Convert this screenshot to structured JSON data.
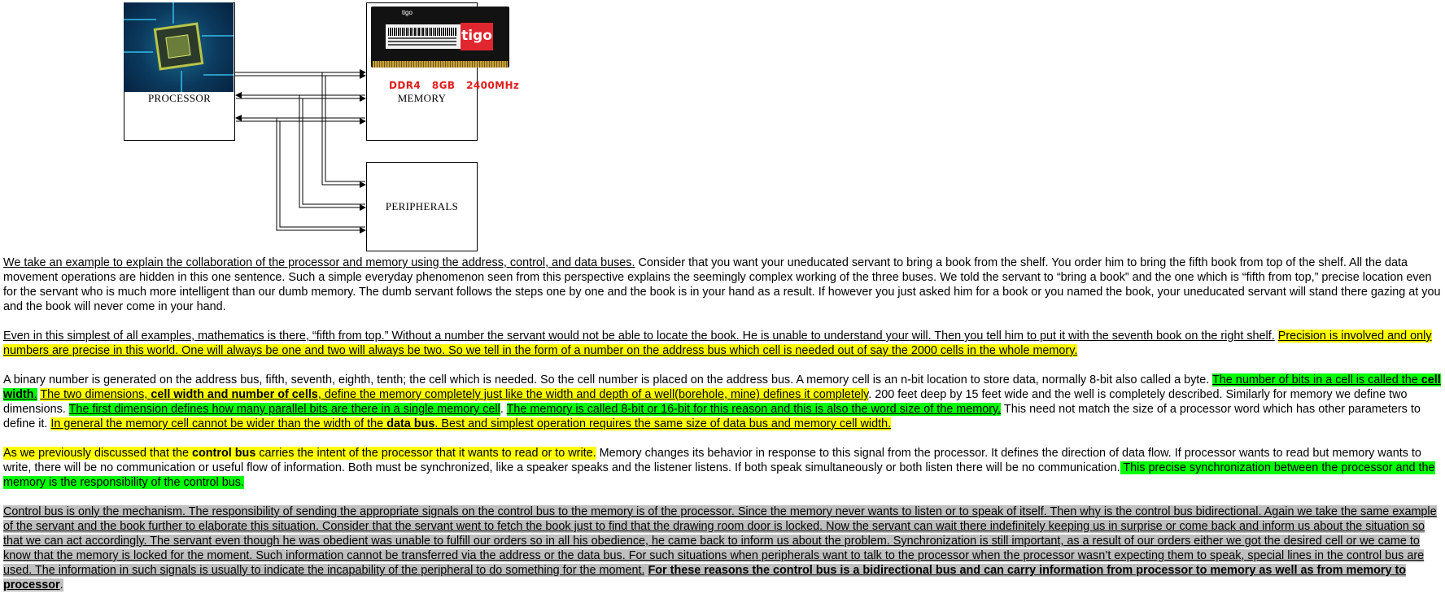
{
  "diagram": {
    "processor_label": "PROCESSOR",
    "memory_label": "MEMORY",
    "peripherals_label": "PERIPHERALS",
    "ram_brand": "tigo",
    "ram_spec": "DDR4   8GB   2400MHz",
    "chip_icon": "cpu-chip-image",
    "ram_icon": "ram-module-image"
  },
  "paragraphs": [
    {
      "runs": [
        {
          "t": "We take an example to explain the collaboration of the processor and memory using the address, control, and data buses.",
          "u": true
        },
        {
          "t": " Consider that you want your uneducated servant to bring a book from the shelf. You order him to bring the fifth book from top of the shelf. All the data movement operations are hidden in this one sentence. Such a simple everyday phenomenon seen from this perspective explains the seemingly complex working of the three buses. We told the servant to “bring a book” and the one which is “fifth from top,” precise location even for the servant who is much more intelligent than our dumb memory. The dumb servant follows the steps one by one and the book is in your hand as a result. If however you just asked him for a book or you named the book, your uneducated servant will stand there gazing at you and the book will never come in your hand."
        }
      ]
    },
    {
      "runs": [
        {
          "t": "Even in this simplest of all examples, mathematics is there, “fifth from top.” Without a number the servant would not be able to locate the book. He is unable to understand your will. Then you tell him to put it with the seventh book on the right shelf.",
          "u": true
        },
        {
          "t": " "
        },
        {
          "t": "Precision is involved and only numbers are precise in this world. One will always be one and two will always be two. So we tell in the form of a number on the address bus which cell is needed out of say the 2000 cells in the whole memory.",
          "u": true,
          "h": "yellow"
        }
      ]
    },
    {
      "runs": [
        {
          "t": "A binary number is generated on the address bus, fifth, seventh, eighth, tenth; the cell which is needed. So the cell number is placed on the address bus. A memory cell is an n-bit location to store data, normally 8-bit also called a byte. "
        },
        {
          "t": "The number of bits in a cell is called the ",
          "u": true,
          "h": "green"
        },
        {
          "t": "cell width",
          "u": true,
          "b": true,
          "h": "green"
        },
        {
          "t": ".",
          "u": true,
          "h": "green"
        },
        {
          "t": " "
        },
        {
          "t": "The two dimensions, ",
          "u": true,
          "h": "yellow"
        },
        {
          "t": "cell width and number of cells",
          "u": true,
          "b": true,
          "h": "yellow"
        },
        {
          "t": ", define the memory completely just like the width and depth of a well(borehole, mine) defines it completely",
          "u": true,
          "h": "yellow"
        },
        {
          "t": ". 200 feet deep by 15 feet wide and the well is completely described. Similarly for memory we define two dimensions. "
        },
        {
          "t": "The first dimension defines how many parallel bits are there in a single memory cell",
          "u": true,
          "h": "green"
        },
        {
          "t": ". "
        },
        {
          "t": "The memory is called 8-bit or 16-bit for this reason and this is also the word size of the memory.",
          "u": true,
          "h": "green"
        },
        {
          "t": " This need not match the size of a processor word which has other parameters to define it. "
        },
        {
          "t": "In general the memory cell cannot be wider than the width of the ",
          "u": true,
          "h": "yellow"
        },
        {
          "t": "data bus",
          "u": true,
          "b": true,
          "h": "yellow"
        },
        {
          "t": ". Best and simplest operation requires the same size of data bus and memory cell width. ",
          "u": true,
          "h": "yellow"
        }
      ]
    },
    {
      "runs": [
        {
          "t": "As we previously discussed that the ",
          "h": "yellow"
        },
        {
          "t": "control bus",
          "b": true,
          "h": "yellow"
        },
        {
          "t": " carries the intent of the processor that it wants to read or to write.",
          "h": "yellow"
        },
        {
          "t": " Memory changes its behavior in response to this signal from the processor. It defines the direction of data flow. If processor wants to read but memory wants to write, there will be no communication or useful flow of information. Both must be synchronized, like a speaker speaks and the listener listens. If both speak simultaneously or both listen there will be no communication."
        },
        {
          "t": " This precise synchronization between the processor and the memory is the responsibility of the control bus.",
          "h": "green"
        }
      ]
    },
    {
      "runs": [
        {
          "t": "Control bus is only the mechanism. The responsibility of sending the appropriate signals on the control bus to the memory is of the processor. Since the memory never wants to listen or to speak of itself. Then why is the control bus bidirectional. Again we take the same example of the servant and the book further to elaborate this situation. Consider that the servant went to fetch the book just to find that the drawing room door is locked. Now the servant can wait there indefinitely keeping us in surprise or come back and inform us about the situation so that we can act accordingly. The servant even though he was obedient was unable to fulfill our orders so in all his obedience, he came back to inform us about the problem. Synchronization is still important, as a result of our orders either we got the desired cell or we came to know that the memory is locked for the moment. Such information cannot be transferred via the address or the data bus. For such situations when peripherals want to talk to the processor when the processor wasn’t expecting them to speak, special lines in the control bus are used. The information in such signals is usually to indicate the incapability of the peripheral to do something for the moment.",
          "u": true,
          "h": "gray"
        },
        {
          "t": " ",
          "h": "gray"
        },
        {
          "t": "For these reasons the control bus is a bidirectional bus and can carry information from processor to memory as well as from memory to processor",
          "b": true,
          "u": true,
          "h": "gray"
        },
        {
          "t": ".",
          "h": "gray"
        }
      ]
    }
  ]
}
